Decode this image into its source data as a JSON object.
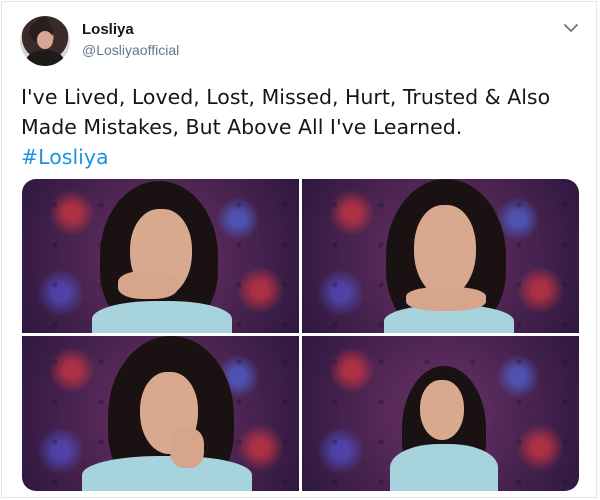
{
  "tweet": {
    "author": {
      "display_name": "Losliya",
      "handle": "@Losliyaofficial",
      "avatar_icon": "profile-avatar"
    },
    "menu_icon": "chevron-down-icon",
    "text_line_1": "I've Lived, Loved, Lost, Missed, Hurt, Trusted & Also",
    "text_line_2": "Made Mistakes, But Above All I've Learned.",
    "hashtag": "#Losliya",
    "colors": {
      "hashtag": "#1b95e0",
      "text": "#14171a",
      "secondary": "#657786",
      "border": "#e1e8ed"
    },
    "media": {
      "photos": [
        {
          "name": "photo-1"
        },
        {
          "name": "photo-2"
        },
        {
          "name": "photo-3"
        },
        {
          "name": "photo-4"
        }
      ]
    }
  }
}
